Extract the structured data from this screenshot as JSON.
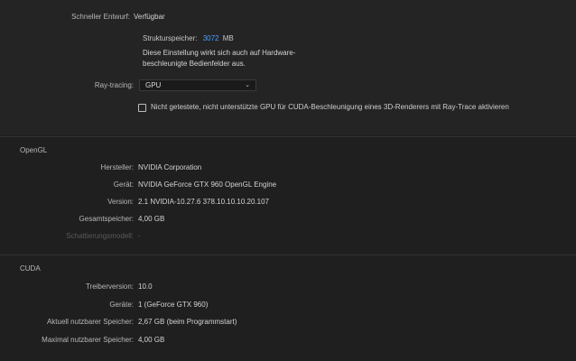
{
  "fast_draft": {
    "label": "Schneller Entwurf:",
    "value": "Verfügbar"
  },
  "texture_memory": {
    "label": "Strukturspeicher:",
    "value": "3072",
    "unit": "MB",
    "note_line1": "Diese Einstellung wirkt sich auch auf Hardware-",
    "note_line2": "beschleunigte Bedienfelder aus."
  },
  "raytracing": {
    "label": "Ray-tracing:",
    "selected": "GPU"
  },
  "untested_gpu": {
    "label": "Nicht getestete, nicht unterstützte GPU für CUDA-Beschleunigung eines 3D-Renderers mit Ray-Trace aktivieren",
    "checked": false
  },
  "opengl": {
    "title": "OpenGL",
    "rows": [
      {
        "label": "Hersteller:",
        "value": "NVIDIA Corporation"
      },
      {
        "label": "Gerät:",
        "value": "NVIDIA GeForce GTX 960 OpenGL Engine"
      },
      {
        "label": "Version:",
        "value": "2.1 NVIDIA-10.27.6 378.10.10.10.20.107"
      },
      {
        "label": "Gesamtspeicher:",
        "value": "4,00 GB"
      },
      {
        "label": "Schattierungsmodell:",
        "value": "-"
      }
    ]
  },
  "cuda": {
    "title": "CUDA",
    "rows": [
      {
        "label": "Treiberversion:",
        "value": "10.0"
      },
      {
        "label": "Geräte:",
        "value": "1 (GeForce GTX 960)"
      },
      {
        "label": "Aktuell nutzbarer Speicher:",
        "value": "2,67 GB (beim Programmstart)"
      },
      {
        "label": "Maximal nutzbarer Speicher:",
        "value": "4,00 GB"
      }
    ]
  }
}
